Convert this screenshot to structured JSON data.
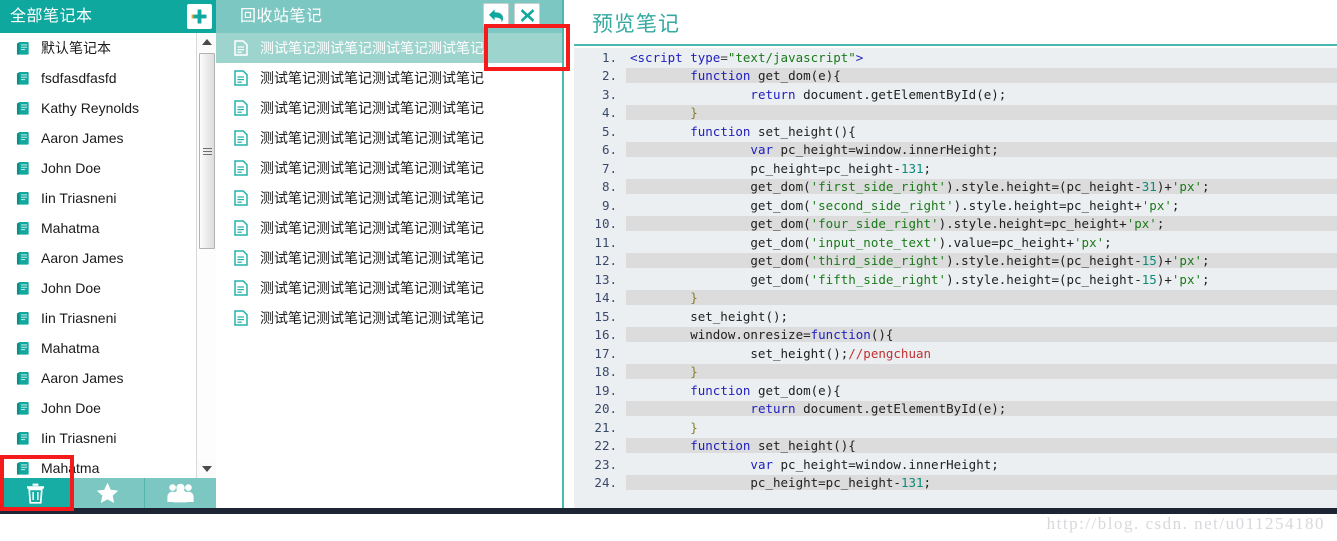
{
  "sidebar": {
    "title": "全部笔记本",
    "add_button": "add-notebook",
    "items": [
      {
        "label": "默认笔记本",
        "icon": "notebook-icon"
      },
      {
        "label": "fsdfasdfasfd",
        "icon": "notebook-icon"
      },
      {
        "label": "Kathy Reynolds",
        "icon": "notebook-icon"
      },
      {
        "label": "Aaron James",
        "icon": "notebook-icon"
      },
      {
        "label": "John Doe",
        "icon": "notebook-icon"
      },
      {
        "label": "Iin Triasneni",
        "icon": "notebook-icon"
      },
      {
        "label": "Mahatma",
        "icon": "notebook-icon"
      },
      {
        "label": "Aaron James",
        "icon": "notebook-icon"
      },
      {
        "label": "John Doe",
        "icon": "notebook-icon"
      },
      {
        "label": "Iin Triasneni",
        "icon": "notebook-icon"
      },
      {
        "label": "Mahatma",
        "icon": "notebook-icon"
      },
      {
        "label": "Aaron James",
        "icon": "notebook-icon"
      },
      {
        "label": "John Doe",
        "icon": "notebook-icon"
      },
      {
        "label": "Iin Triasneni",
        "icon": "notebook-icon"
      },
      {
        "label": "Mahatma",
        "icon": "notebook-icon"
      }
    ],
    "toolbar": [
      {
        "name": "trash-icon",
        "active": true
      },
      {
        "name": "star-icon",
        "active": false
      },
      {
        "name": "group-icon",
        "active": false
      }
    ]
  },
  "notelist": {
    "title": "回收站笔记",
    "actions": [
      {
        "name": "restore-button",
        "icon": "undo-arrow-icon"
      },
      {
        "name": "delete-button",
        "icon": "close-x-icon"
      }
    ],
    "items": [
      {
        "label": "测试笔记测试笔记测试笔记测试笔记",
        "selected": true
      },
      {
        "label": "测试笔记测试笔记测试笔记测试笔记",
        "selected": false
      },
      {
        "label": "测试笔记测试笔记测试笔记测试笔记",
        "selected": false
      },
      {
        "label": "测试笔记测试笔记测试笔记测试笔记",
        "selected": false
      },
      {
        "label": "测试笔记测试笔记测试笔记测试笔记",
        "selected": false
      },
      {
        "label": "测试笔记测试笔记测试笔记测试笔记",
        "selected": false
      },
      {
        "label": "测试笔记测试笔记测试笔记测试笔记",
        "selected": false
      },
      {
        "label": "测试笔记测试笔记测试笔记测试笔记",
        "selected": false
      },
      {
        "label": "测试笔记测试笔记测试笔记测试笔记",
        "selected": false
      },
      {
        "label": "测试笔记测试笔记测试笔记测试笔记",
        "selected": false
      }
    ]
  },
  "preview": {
    "title": "预览笔记",
    "code_lines": [
      {
        "n": "1.",
        "tokens": [
          {
            "t": "<script ",
            "c": "tag"
          },
          {
            "t": "type",
            "c": "attr"
          },
          {
            "t": "=",
            "c": "punc"
          },
          {
            "t": "\"text/javascript\"",
            "c": "str"
          },
          {
            "t": ">",
            "c": "tag"
          }
        ]
      },
      {
        "n": "2.",
        "tokens": [
          {
            "t": "        ",
            "c": "plain"
          },
          {
            "t": "function",
            "c": "kw"
          },
          {
            "t": " get_dom(e){",
            "c": "plain"
          }
        ]
      },
      {
        "n": "3.",
        "tokens": [
          {
            "t": "                ",
            "c": "plain"
          },
          {
            "t": "return",
            "c": "kw"
          },
          {
            "t": " document.getElementById(e);",
            "c": "plain"
          }
        ]
      },
      {
        "n": "4.",
        "tokens": [
          {
            "t": "        }",
            "c": "brace"
          }
        ]
      },
      {
        "n": "5.",
        "tokens": [
          {
            "t": "        ",
            "c": "plain"
          },
          {
            "t": "function",
            "c": "kw"
          },
          {
            "t": " set_height(){",
            "c": "plain"
          }
        ]
      },
      {
        "n": "6.",
        "tokens": [
          {
            "t": "                ",
            "c": "plain"
          },
          {
            "t": "var",
            "c": "kw"
          },
          {
            "t": " pc_height=window.innerHeight;",
            "c": "plain"
          }
        ]
      },
      {
        "n": "7.",
        "tokens": [
          {
            "t": "                pc_height=pc_height-",
            "c": "plain"
          },
          {
            "t": "131",
            "c": "num"
          },
          {
            "t": ";",
            "c": "plain"
          }
        ]
      },
      {
        "n": "8.",
        "tokens": [
          {
            "t": "                get_dom(",
            "c": "plain"
          },
          {
            "t": "'first_side_right'",
            "c": "str"
          },
          {
            "t": ").style.height=(pc_height-",
            "c": "plain"
          },
          {
            "t": "31",
            "c": "num"
          },
          {
            "t": ")+",
            "c": "plain"
          },
          {
            "t": "'px'",
            "c": "str"
          },
          {
            "t": ";",
            "c": "plain"
          }
        ]
      },
      {
        "n": "9.",
        "tokens": [
          {
            "t": "                get_dom(",
            "c": "plain"
          },
          {
            "t": "'second_side_right'",
            "c": "str"
          },
          {
            "t": ").style.height=pc_height+",
            "c": "plain"
          },
          {
            "t": "'px'",
            "c": "str"
          },
          {
            "t": ";",
            "c": "plain"
          }
        ]
      },
      {
        "n": "10.",
        "tokens": [
          {
            "t": "                get_dom(",
            "c": "plain"
          },
          {
            "t": "'four_side_right'",
            "c": "str"
          },
          {
            "t": ").style.height=pc_height+",
            "c": "plain"
          },
          {
            "t": "'px'",
            "c": "str"
          },
          {
            "t": ";",
            "c": "plain"
          }
        ]
      },
      {
        "n": "11.",
        "tokens": [
          {
            "t": "                get_dom(",
            "c": "plain"
          },
          {
            "t": "'input_note_text'",
            "c": "str"
          },
          {
            "t": ").value=pc_height+",
            "c": "plain"
          },
          {
            "t": "'px'",
            "c": "str"
          },
          {
            "t": ";",
            "c": "plain"
          }
        ]
      },
      {
        "n": "12.",
        "tokens": [
          {
            "t": "                get_dom(",
            "c": "plain"
          },
          {
            "t": "'third_side_right'",
            "c": "str"
          },
          {
            "t": ").style.height=(pc_height-",
            "c": "plain"
          },
          {
            "t": "15",
            "c": "num"
          },
          {
            "t": ")+",
            "c": "plain"
          },
          {
            "t": "'px'",
            "c": "str"
          },
          {
            "t": ";",
            "c": "plain"
          }
        ]
      },
      {
        "n": "13.",
        "tokens": [
          {
            "t": "                get_dom(",
            "c": "plain"
          },
          {
            "t": "'fifth_side_right'",
            "c": "str"
          },
          {
            "t": ").style.height=(pc_height-",
            "c": "plain"
          },
          {
            "t": "15",
            "c": "num"
          },
          {
            "t": ")+",
            "c": "plain"
          },
          {
            "t": "'px'",
            "c": "str"
          },
          {
            "t": ";",
            "c": "plain"
          }
        ]
      },
      {
        "n": "14.",
        "tokens": [
          {
            "t": "        }",
            "c": "brace"
          }
        ]
      },
      {
        "n": "15.",
        "tokens": [
          {
            "t": "        set_height();",
            "c": "plain"
          }
        ]
      },
      {
        "n": "16.",
        "tokens": [
          {
            "t": "        window.onresize=",
            "c": "plain"
          },
          {
            "t": "function",
            "c": "kw"
          },
          {
            "t": "(){",
            "c": "plain"
          }
        ]
      },
      {
        "n": "17.",
        "tokens": [
          {
            "t": "                set_height();",
            "c": "plain"
          },
          {
            "t": "//pengchuan",
            "c": "com"
          }
        ]
      },
      {
        "n": "18.",
        "tokens": [
          {
            "t": "        }",
            "c": "brace"
          }
        ]
      },
      {
        "n": "19.",
        "tokens": [
          {
            "t": "        ",
            "c": "plain"
          },
          {
            "t": "function",
            "c": "kw"
          },
          {
            "t": " get_dom(e){",
            "c": "plain"
          }
        ]
      },
      {
        "n": "20.",
        "tokens": [
          {
            "t": "                ",
            "c": "plain"
          },
          {
            "t": "return",
            "c": "kw"
          },
          {
            "t": " document.getElementById(e);",
            "c": "plain"
          }
        ]
      },
      {
        "n": "21.",
        "tokens": [
          {
            "t": "        }",
            "c": "brace"
          }
        ]
      },
      {
        "n": "22.",
        "tokens": [
          {
            "t": "        ",
            "c": "plain"
          },
          {
            "t": "function",
            "c": "kw"
          },
          {
            "t": " set_height(){",
            "c": "plain"
          }
        ]
      },
      {
        "n": "23.",
        "tokens": [
          {
            "t": "                ",
            "c": "plain"
          },
          {
            "t": "var",
            "c": "kw"
          },
          {
            "t": " pc_height=window.innerHeight;",
            "c": "plain"
          }
        ]
      },
      {
        "n": "24.",
        "tokens": [
          {
            "t": "                pc_height=pc_height-",
            "c": "plain"
          },
          {
            "t": "131",
            "c": "num"
          },
          {
            "t": ";",
            "c": "plain"
          }
        ]
      }
    ]
  },
  "watermark": "http://blog. csdn. net/u011254180",
  "colors": {
    "header_dark_teal": "#0fa89f",
    "header_light_teal": "#7cc7c1",
    "selected_row": "#9ed4ce",
    "accent_teal": "#33a9a1",
    "annotation_red": "#f51b1b",
    "footer_dark": "#1d2433",
    "code_bg": "#eceff1",
    "code_alt_row": "#dcdcdc"
  }
}
